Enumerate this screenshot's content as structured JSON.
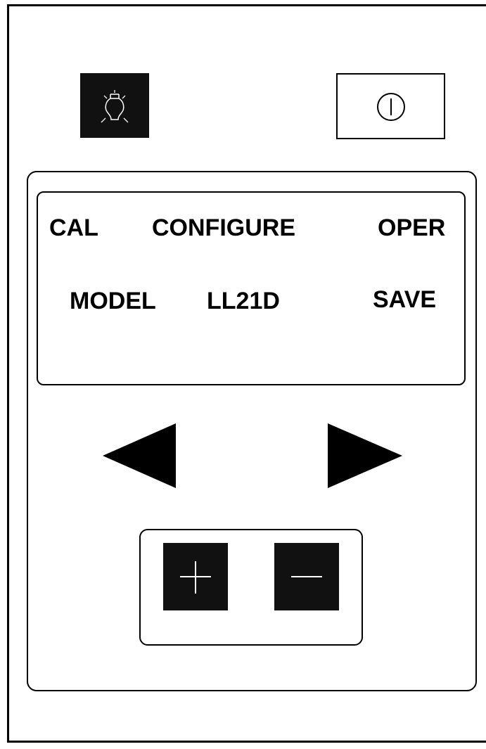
{
  "buttons": {
    "lamp_icon": "light-bulb",
    "power_icon": "power-symbol",
    "plus_icon": "plus",
    "minus_icon": "minus",
    "left_icon": "left-triangle-arrow",
    "right_icon": "right-triangle-arrow"
  },
  "display": {
    "row1": {
      "left": "CAL",
      "center": "CONFIGURE",
      "right": "OPER"
    },
    "row2": {
      "left": "MODEL",
      "center": "LL21D",
      "right": "SAVE"
    }
  },
  "colors": {
    "ink": "#000000",
    "key_fill": "#111111",
    "background": "#ffffff"
  }
}
